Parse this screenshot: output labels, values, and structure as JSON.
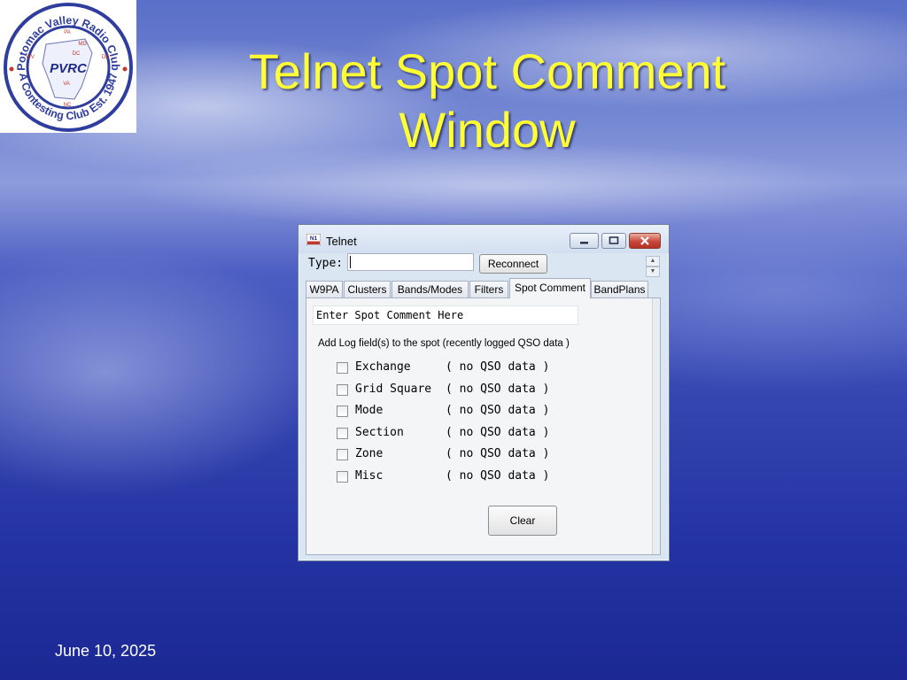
{
  "slide": {
    "title_line1": "Telnet Spot Comment",
    "title_line2": "Window",
    "footer_date": "June 10, 2025",
    "title_color": "#ffff33"
  },
  "logo": {
    "arc_text": "Potomac Valley Radio Club",
    "center_text": "PVRC",
    "bottom_text": "A Contesting Club Est. 1947",
    "states": [
      "PA",
      "MD",
      "DC",
      "DE",
      "WV",
      "VA",
      "NC"
    ]
  },
  "window": {
    "title": "Telnet",
    "app_icon_text": "N1",
    "type_label": "Type:",
    "type_value": "",
    "reconnect_label": "Reconnect",
    "tabs": [
      {
        "label": "W9PA",
        "active": false
      },
      {
        "label": "Clusters",
        "active": false
      },
      {
        "label": "Bands/Modes",
        "active": false
      },
      {
        "label": "Filters",
        "active": false
      },
      {
        "label": "Spot Comment",
        "active": true
      },
      {
        "label": "BandPlans",
        "active": false
      }
    ],
    "comment_placeholder": "Enter Spot Comment Here",
    "hint": "Add Log field(s) to the spot (recently logged QSO data )",
    "fields": [
      {
        "name": "Exchange",
        "value": "( no QSO data )",
        "checked": false
      },
      {
        "name": "Grid Square",
        "value": "( no QSO data )",
        "checked": false
      },
      {
        "name": "Mode",
        "value": "( no QSO data )",
        "checked": false
      },
      {
        "name": "Section",
        "value": "( no QSO data )",
        "checked": false
      },
      {
        "name": "Zone",
        "value": "( no QSO data )",
        "checked": false
      },
      {
        "name": "Misc",
        "value": "( no QSO data )",
        "checked": false
      }
    ],
    "clear_label": "Clear"
  }
}
